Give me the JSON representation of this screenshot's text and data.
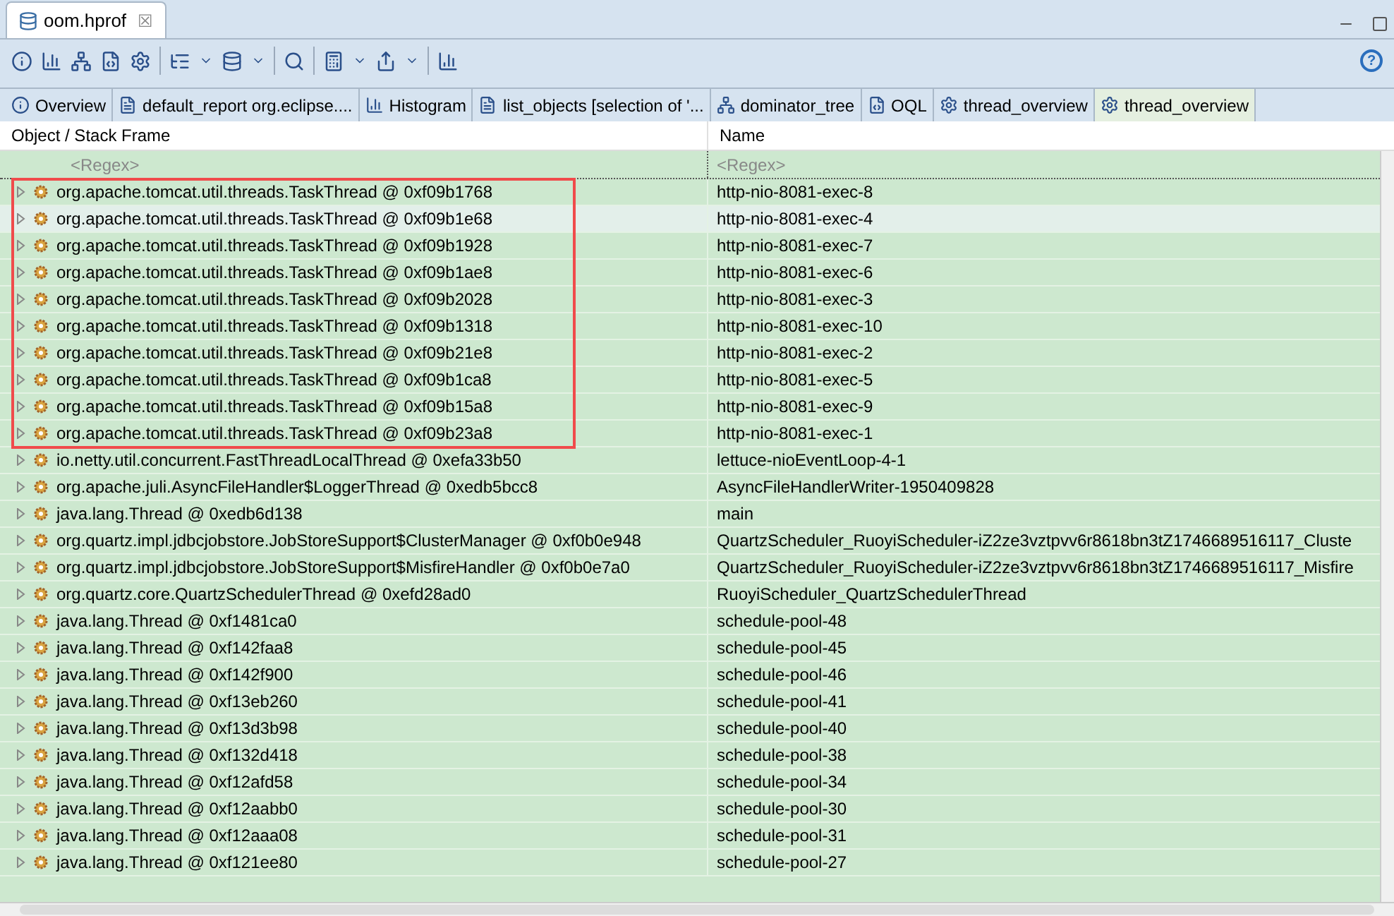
{
  "editor_tab": {
    "title": "oom.hprof",
    "close": "☒"
  },
  "tabs": [
    {
      "label": "Overview",
      "selected": false
    },
    {
      "label": "default_report  org.eclipse....",
      "selected": false
    },
    {
      "label": "Histogram",
      "selected": false
    },
    {
      "label": "list_objects  [selection of '...",
      "selected": false
    },
    {
      "label": "dominator_tree",
      "selected": false
    },
    {
      "label": "OQL",
      "selected": false
    },
    {
      "label": "thread_overview",
      "selected": false
    },
    {
      "label": "thread_overview",
      "selected": true
    }
  ],
  "table": {
    "columns": [
      "Object / Stack Frame",
      "Name"
    ],
    "filter": {
      "placeholder_object": "<Regex>",
      "placeholder_name": "<Regex>"
    },
    "rows": [
      {
        "object": "org.apache.tomcat.util.threads.TaskThread @ 0xf09b1768",
        "name": "http-nio-8081-exec-8",
        "selected": false
      },
      {
        "object": "org.apache.tomcat.util.threads.TaskThread @ 0xf09b1e68",
        "name": "http-nio-8081-exec-4",
        "selected": true
      },
      {
        "object": "org.apache.tomcat.util.threads.TaskThread @ 0xf09b1928",
        "name": "http-nio-8081-exec-7",
        "selected": false
      },
      {
        "object": "org.apache.tomcat.util.threads.TaskThread @ 0xf09b1ae8",
        "name": "http-nio-8081-exec-6",
        "selected": false
      },
      {
        "object": "org.apache.tomcat.util.threads.TaskThread @ 0xf09b2028",
        "name": "http-nio-8081-exec-3",
        "selected": false
      },
      {
        "object": "org.apache.tomcat.util.threads.TaskThread @ 0xf09b1318",
        "name": "http-nio-8081-exec-10",
        "selected": false
      },
      {
        "object": "org.apache.tomcat.util.threads.TaskThread @ 0xf09b21e8",
        "name": "http-nio-8081-exec-2",
        "selected": false
      },
      {
        "object": "org.apache.tomcat.util.threads.TaskThread @ 0xf09b1ca8",
        "name": "http-nio-8081-exec-5",
        "selected": false
      },
      {
        "object": "org.apache.tomcat.util.threads.TaskThread @ 0xf09b15a8",
        "name": "http-nio-8081-exec-9",
        "selected": false
      },
      {
        "object": "org.apache.tomcat.util.threads.TaskThread @ 0xf09b23a8",
        "name": "http-nio-8081-exec-1",
        "selected": false
      },
      {
        "object": "io.netty.util.concurrent.FastThreadLocalThread @ 0xefa33b50",
        "name": "lettuce-nioEventLoop-4-1",
        "selected": false
      },
      {
        "object": "org.apache.juli.AsyncFileHandler$LoggerThread @ 0xedb5bcc8",
        "name": "AsyncFileHandlerWriter-1950409828",
        "selected": false
      },
      {
        "object": "java.lang.Thread @ 0xedb6d138",
        "name": "main",
        "selected": false
      },
      {
        "object": "org.quartz.impl.jdbcjobstore.JobStoreSupport$ClusterManager @ 0xf0b0e948",
        "name": "QuartzScheduler_RuoyiScheduler-iZ2ze3vztpvv6r8618bn3tZ1746689516117_Cluste",
        "selected": false
      },
      {
        "object": "org.quartz.impl.jdbcjobstore.JobStoreSupport$MisfireHandler @ 0xf0b0e7a0",
        "name": "QuartzScheduler_RuoyiScheduler-iZ2ze3vztpvv6r8618bn3tZ1746689516117_Misfire",
        "selected": false
      },
      {
        "object": "org.quartz.core.QuartzSchedulerThread @ 0xefd28ad0",
        "name": "RuoyiScheduler_QuartzSchedulerThread",
        "selected": false
      },
      {
        "object": "java.lang.Thread @ 0xf1481ca0",
        "name": "schedule-pool-48",
        "selected": false
      },
      {
        "object": "java.lang.Thread @ 0xf142faa8",
        "name": "schedule-pool-45",
        "selected": false
      },
      {
        "object": "java.lang.Thread @ 0xf142f900",
        "name": "schedule-pool-46",
        "selected": false
      },
      {
        "object": "java.lang.Thread @ 0xf13eb260",
        "name": "schedule-pool-41",
        "selected": false
      },
      {
        "object": "java.lang.Thread @ 0xf13d3b98",
        "name": "schedule-pool-40",
        "selected": false
      },
      {
        "object": "java.lang.Thread @ 0xf132d418",
        "name": "schedule-pool-38",
        "selected": false
      },
      {
        "object": "java.lang.Thread @ 0xf12afd58",
        "name": "schedule-pool-34",
        "selected": false
      },
      {
        "object": "java.lang.Thread @ 0xf12aabb0",
        "name": "schedule-pool-30",
        "selected": false
      },
      {
        "object": "java.lang.Thread @ 0xf12aaa08",
        "name": "schedule-pool-31",
        "selected": false
      },
      {
        "object": "java.lang.Thread @ 0xf121ee80",
        "name": "schedule-pool-27",
        "selected": false
      }
    ]
  },
  "help": "?"
}
